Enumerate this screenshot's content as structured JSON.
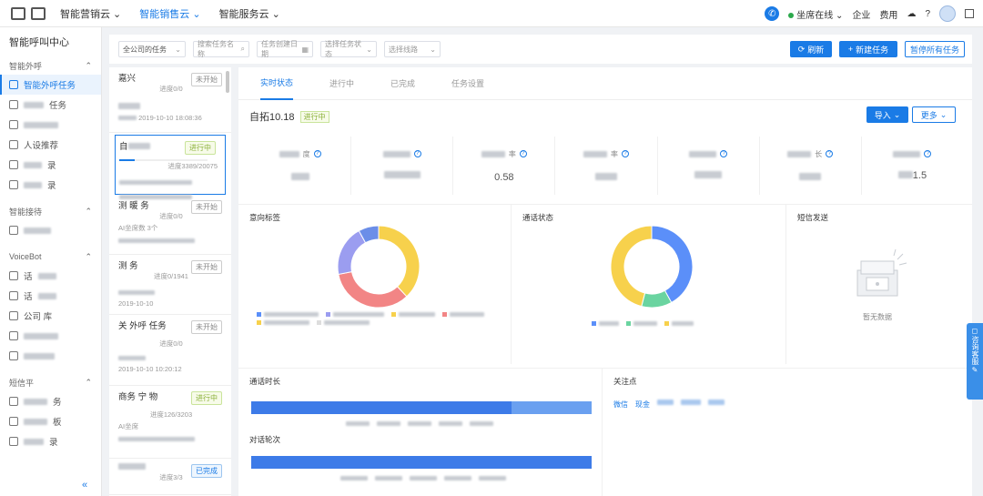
{
  "topnav": {
    "items": [
      "智能营销云",
      "智能销售云",
      "智能服务云"
    ],
    "seat_status": "坐席在线",
    "enterprise": "企业",
    "cost": "费用"
  },
  "sidebar": {
    "title": "智能呼叫中心",
    "groups": [
      {
        "label": "智能外呼",
        "items": [
          "智能外呼任务",
          "任务",
          "",
          "人设推荐",
          "录",
          "录"
        ]
      },
      {
        "label": "智能接待",
        "items": [
          ""
        ]
      },
      {
        "label": "VoiceBot",
        "items": [
          "话",
          "话",
          "公司 库",
          "",
          ""
        ]
      },
      {
        "label": "短信平",
        "items": [
          "务",
          "板",
          "录"
        ]
      }
    ],
    "collapse_icon": "«"
  },
  "filters": {
    "scope": "全公司的任务",
    "name_placeholder": "搜索任务名称",
    "date_placeholder": "任务创建日期",
    "status_placeholder": "选择任务状态",
    "line_placeholder": "选择线路",
    "refresh": "刷新",
    "new_task": "新建任务",
    "pause_all": "暂停所有任务"
  },
  "tasks": [
    {
      "name": "嘉兴",
      "tag": "未开始",
      "tag_type": "idle",
      "progress": "进度0/0",
      "meta": "2019-10-10 18:08:36"
    },
    {
      "name": "自",
      "tag": "进行中",
      "tag_type": "run",
      "progress": "进度3389/20075",
      "meta": ""
    },
    {
      "name": "测 暖 务",
      "tag": "未开始",
      "tag_type": "idle",
      "progress": "进度0/0",
      "meta": "AI坐席数 3个"
    },
    {
      "name": "测 务",
      "tag": "未开始",
      "tag_type": "idle",
      "progress": "进度0/1941",
      "meta": "2019-10-10"
    },
    {
      "name": "关 外呼 任务",
      "tag": "未开始",
      "tag_type": "idle",
      "progress": "进度0/0",
      "meta": "2019-10-10 10:20:12"
    },
    {
      "name": "商务 宁 物",
      "tag": "进行中",
      "tag_type": "run",
      "progress": "进度126/3203",
      "meta": "AI坐席"
    },
    {
      "name": "",
      "tag": "已完成",
      "tag_type": "done",
      "progress": "进度3/3",
      "meta": ""
    }
  ],
  "main": {
    "tabs": [
      "实时状态",
      "进行中",
      "已完成",
      "任务设置"
    ],
    "task_name": "自拓10.18",
    "task_status": "进行中",
    "import_btn": "导入",
    "more_btn": "更多",
    "stats": [
      {
        "label": "度",
        "value": ""
      },
      {
        "label": "",
        "value": ""
      },
      {
        "label": "率",
        "value": "0.58"
      },
      {
        "label": "率",
        "value": ""
      },
      {
        "label": "",
        "value": ""
      },
      {
        "label": "长",
        "value": ""
      },
      {
        "label": "",
        "value": "1.5"
      }
    ],
    "panels": {
      "intent": "意向标签",
      "call_status": "通话状态",
      "sms": "短信发送",
      "sms_empty": "暂无数据",
      "call_duration": "通话时长",
      "dialog_rounds": "对话轮次",
      "focus": "关注点",
      "focus_items": [
        "微信",
        "现金",
        "",
        ""
      ]
    },
    "float_panel": "咨询客服"
  },
  "colors": {
    "primary": "#1a7be6",
    "running": "#8bb13a",
    "donut_yellow": "#f7d14c",
    "donut_red": "#f28585",
    "donut_purple": "#9b9df0",
    "donut_blue": "#5b8ff9",
    "donut_green": "#6ad4a0"
  },
  "chart_data": [
    {
      "type": "pie",
      "title": "意向标签",
      "labels": [
        "",
        "",
        "",
        "",
        ""
      ],
      "values": [
        38,
        34,
        20,
        8
      ]
    },
    {
      "type": "pie",
      "title": "通话状态",
      "labels": [
        "",
        "",
        ""
      ],
      "values": [
        42,
        12,
        46
      ]
    }
  ]
}
